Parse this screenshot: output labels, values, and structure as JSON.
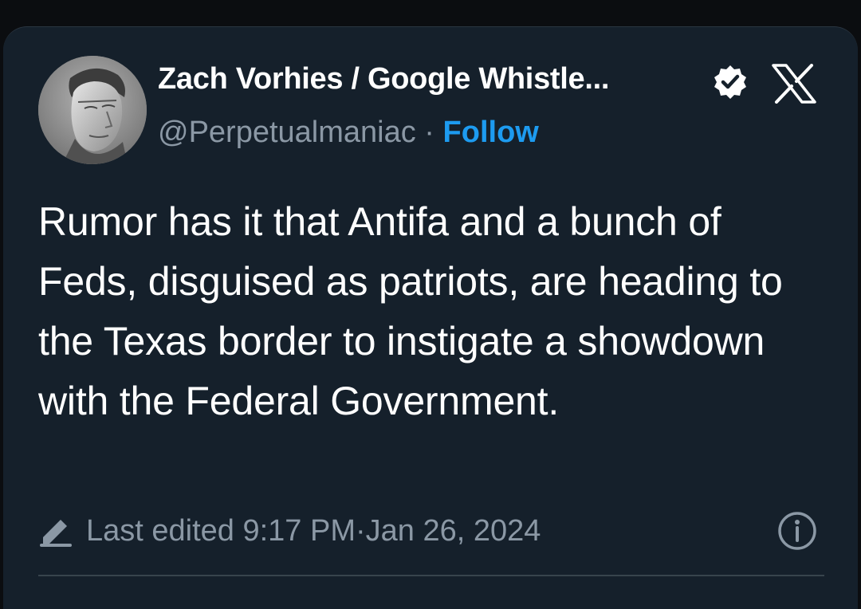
{
  "tweet": {
    "author": {
      "display_name": "Zach Vorhies / Google Whistle...",
      "handle": "@Perpetualmaniac",
      "separator": " · ",
      "follow_label": "Follow",
      "verified": true
    },
    "text": "Rumor has it that Antifa and a bunch of Feds, disguised as patriots, are heading to the Texas border to instigate a showdown with the Federal Government.",
    "edit_label": "Last edited",
    "time": "9:17 PM",
    "date_separator": " · ",
    "date": "Jan 26, 2024"
  },
  "icons": {
    "verified": "verified-badge-icon",
    "platform": "x-logo-icon",
    "edited": "pencil-icon",
    "info": "info-icon"
  },
  "colors": {
    "background": "#15202b",
    "accent": "#1d9bf0",
    "text": "#ffffff",
    "muted": "#8b98a5"
  }
}
